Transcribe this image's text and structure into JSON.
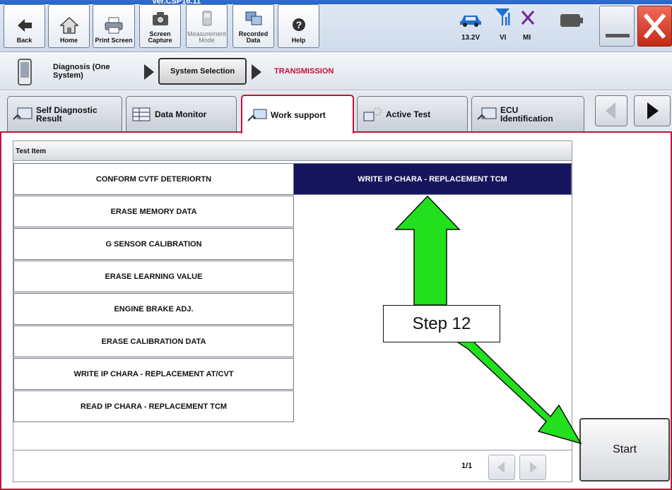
{
  "app": {
    "version": "Ver.CSP16.11"
  },
  "toolbar": {
    "buttons": [
      {
        "label": "Back",
        "icon": "back-arrow-icon"
      },
      {
        "label": "Home",
        "icon": "home-icon"
      },
      {
        "label": "Print Screen",
        "icon": "printer-icon"
      },
      {
        "label": "Screen\nCapture",
        "icon": "camera-icon"
      },
      {
        "label": "Measurement\nMode",
        "icon": "measurement-icon"
      },
      {
        "label": "Recorded\nData",
        "icon": "recorded-data-icon"
      },
      {
        "label": "Help",
        "icon": "help-icon"
      }
    ],
    "status": {
      "voltage": "13.2V",
      "vi_label": "VI",
      "mi_label": "MI"
    }
  },
  "breadcrumb": {
    "diagnosis": "Diagnosis (One System)",
    "system_selection": "System Selection",
    "current": "TRANSMISSION"
  },
  "tabs": [
    {
      "label": "Self Diagnostic Result",
      "icon": "self-diagnostic-icon"
    },
    {
      "label": "Data Monitor",
      "icon": "data-monitor-icon"
    },
    {
      "label": "Work support",
      "icon": "work-support-icon"
    },
    {
      "label": "Active Test",
      "icon": "active-test-icon"
    },
    {
      "label": "ECU Identification",
      "icon": "ecu-identification-icon"
    }
  ],
  "list": {
    "header": "Test Item",
    "left_items": [
      "CONFORM CVTF DETERIORTN",
      "ERASE MEMORY DATA",
      "G SENSOR CALIBRATION",
      "ERASE LEARNING VALUE",
      "ENGINE BRAKE ADJ.",
      "ERASE CALIBRATION DATA",
      "WRITE IP CHARA - REPLACEMENT AT/CVT",
      "READ IP CHARA - REPLACEMENT TCM"
    ],
    "right_items": [
      "WRITE IP CHARA - REPLACEMENT TCM"
    ],
    "page_indicator": "1/1"
  },
  "start_button": "Start",
  "annotation": {
    "step_label": "Step 12",
    "arrow_color": "#22e01e"
  },
  "colors": {
    "accent": "#c4123a",
    "selected_row": "#15155e"
  }
}
